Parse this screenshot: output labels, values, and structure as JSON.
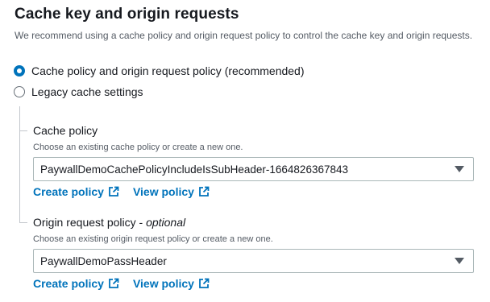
{
  "section": {
    "title": "Cache key and origin requests",
    "description": "We recommend using a cache policy and origin request policy to control the cache key and origin requests."
  },
  "options": [
    {
      "label": "Cache policy and origin request policy (recommended)",
      "selected": true
    },
    {
      "label": "Legacy cache settings",
      "selected": false
    }
  ],
  "cache_policy": {
    "label": "Cache policy",
    "description": "Choose an existing cache policy or create a new one.",
    "value": "PaywallDemoCachePolicyIncludeIsSubHeader-1664826367843",
    "create_link": "Create policy",
    "view_link": "View policy"
  },
  "origin_request_policy": {
    "label": "Origin request policy - ",
    "optional": "optional",
    "description": "Choose an existing origin request policy or create a new one.",
    "value": "PaywallDemoPassHeader",
    "create_link": "Create policy",
    "view_link": "View policy"
  },
  "colors": {
    "accent": "#0073bb",
    "text": "#16191f",
    "muted": "#545b64",
    "border": "#aab7b8"
  },
  "icons": {
    "external": "external-link-icon",
    "dropdown": "caret-down-icon"
  }
}
